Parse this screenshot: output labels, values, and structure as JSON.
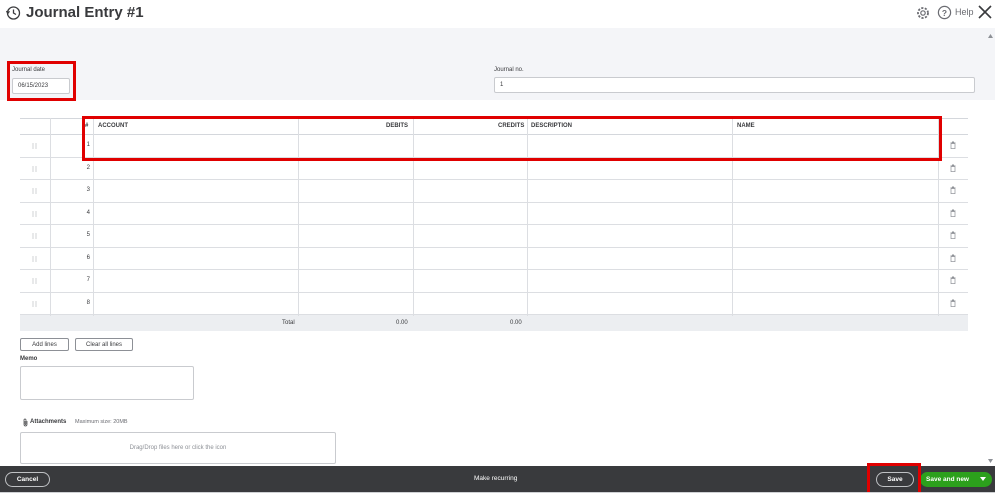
{
  "header": {
    "title": "Journal Entry #1",
    "help_label": "Help",
    "icons": [
      "history-icon",
      "gear-icon",
      "help-icon",
      "close-icon"
    ]
  },
  "form": {
    "journal_date_label": "Journal date",
    "journal_date_value": "06/15/2023",
    "journal_no_label": "Journal no.",
    "journal_no_value": "1"
  },
  "table": {
    "columns": [
      "#",
      "ACCOUNT",
      "DEBITS",
      "CREDITS",
      "DESCRIPTION",
      "NAME"
    ],
    "rows": [
      "1",
      "2",
      "3",
      "4",
      "5",
      "6",
      "7",
      "8"
    ],
    "total_label": "Total",
    "total_debits": "0.00",
    "total_credits": "0.00"
  },
  "actions": {
    "add_lines": "Add lines",
    "clear_all_lines": "Clear all lines"
  },
  "memo": {
    "label": "Memo"
  },
  "attachments": {
    "label": "Attachments",
    "max_size": "Maximum size: 20MB",
    "drop_text": "Drag/Drop files here or click the icon"
  },
  "footer": {
    "cancel": "Cancel",
    "make_recurring": "Make recurring",
    "save": "Save",
    "save_and_new": "Save and new"
  },
  "colors": {
    "accent_green": "#2ca01c",
    "footer_bg": "#393a3d",
    "highlight_red": "#e00000"
  }
}
